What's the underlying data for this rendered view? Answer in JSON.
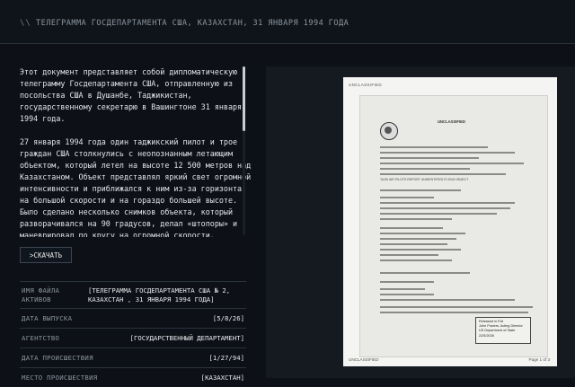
{
  "header": {
    "slash": "\\\\",
    "title": "ТЕЛЕГРАММА ГОСДЕПАРТАМЕНТА США, КАЗАХСТАН, 31 ЯНВАРЯ 1994 ГОДА"
  },
  "description": {
    "p1": "Этот документ представляет собой дипломатическую телеграмму Госдепартамента США, отправленную из посольства США в Душанбе, Таджикистан, государственному секретарю в Вашингтоне 31 января 1994 года.",
    "p2": "27 января 1994 года один таджикский пилот и трое граждан США столкнулись с неопознанным летающим объектом, который летел на высоте 12 500 метров над Казахстаном. Объект представлял яркий свет огромной интенсивности и приближался к ним из-за горизонта на большой скорости и на гораздо большей высоте. Было сделано несколько снимков объекта, который разворачивался на 90 градусов, делал «штопоры» и маневрировал по кругу на огромной скорости. Сообщалось, что в полете объект напоминал пулю. По визуальной оценке, инверсионные следы возникали на высоте 100 000 футов, что слишком высоко для обычных самолётов."
  },
  "download": {
    "label": ">СКАЧАТЬ"
  },
  "meta": [
    {
      "label": "ИМЯ ФАЙЛА АКТИВОВ",
      "value": "[ТЕЛЕГРАММА ГОСДЕПАРТАМЕНТА США № 2, КАЗАХСТАН , 31 ЯНВАРЯ 1994 ГОДА]"
    },
    {
      "label": "ДАТА ВЫПУСКА",
      "value": "[5/8/26]"
    },
    {
      "label": "АГЕНТСТВО",
      "value": "[ГОСУДАРСТВЕННЫЙ ДЕПАРТАМЕНТ]"
    },
    {
      "label": "ДАТА ПРОИСШЕСТВИЯ",
      "value": "[1/27/94]"
    },
    {
      "label": "МЕСТО ПРОИСШЕСТВИЯ",
      "value": "[КАЗАХСТАН]"
    }
  ],
  "document": {
    "classification_top": "UNCLASSIFIED",
    "classification_bottom": "UNCLASSIFIED",
    "heading": "UNCLASSIFIED",
    "subject": "TAJIK AIR PILOTS REPORT UNIDENTIFIED FLYING OBJECT",
    "released_stamp": [
      "Released in Full",
      "John Powers, Acting Director",
      "US Department of State",
      "2/25/2026"
    ],
    "page_number": "Page 1 of 3"
  }
}
